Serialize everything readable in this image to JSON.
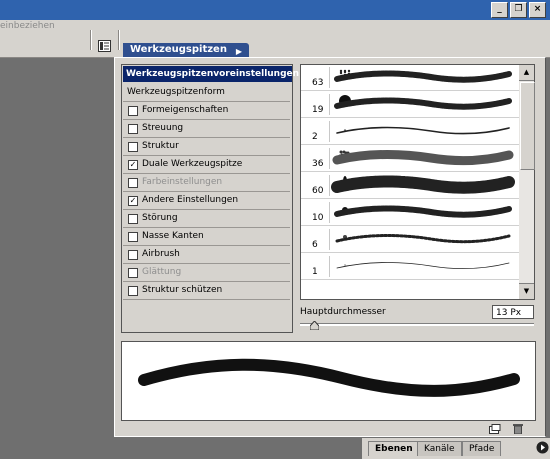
{
  "options_bar": {
    "partial_text": "einbeziehen"
  },
  "window_buttons": [
    "_",
    "❐",
    "×"
  ],
  "palette": {
    "tab_label": "Werkzeugspitzen",
    "tab_arrow": "▶",
    "left_panel": {
      "header": "Werkzeugspitzenvoreinstellungen",
      "items": [
        {
          "label": "Werkzeugspitzenform",
          "checkbox": false,
          "checked": false,
          "enabled": true
        },
        {
          "label": "Formeigenschaften",
          "checkbox": true,
          "checked": false,
          "enabled": true
        },
        {
          "label": "Streuung",
          "checkbox": true,
          "checked": false,
          "enabled": true
        },
        {
          "label": "Struktur",
          "checkbox": true,
          "checked": false,
          "enabled": true
        },
        {
          "label": "Duale Werkzeugspitze",
          "checkbox": true,
          "checked": true,
          "enabled": true
        },
        {
          "label": "Farbeinstellungen",
          "checkbox": true,
          "checked": false,
          "enabled": false
        },
        {
          "label": "Andere Einstellungen",
          "checkbox": true,
          "checked": true,
          "enabled": true
        },
        {
          "label": "Störung",
          "checkbox": true,
          "checked": false,
          "enabled": true
        },
        {
          "label": "Nasse Kanten",
          "checkbox": true,
          "checked": false,
          "enabled": true
        },
        {
          "label": "Airbrush",
          "checkbox": true,
          "checked": false,
          "enabled": true
        },
        {
          "label": "Glättung",
          "checkbox": true,
          "checked": false,
          "enabled": false
        },
        {
          "label": "Struktur schützen",
          "checkbox": true,
          "checked": false,
          "enabled": true
        }
      ]
    },
    "brushes": [
      {
        "size": "63",
        "style": "spatter"
      },
      {
        "size": "19",
        "style": "spatter"
      },
      {
        "size": "2",
        "style": "thin"
      },
      {
        "size": "36",
        "style": "rough"
      },
      {
        "size": "60",
        "style": "grass"
      },
      {
        "size": "10",
        "style": "spatter"
      },
      {
        "size": "6",
        "style": "dotted"
      },
      {
        "size": "1",
        "style": "hair"
      }
    ],
    "diameter": {
      "label": "Hauptdurchmesser",
      "value": "13 Px",
      "fraction": 0.06
    },
    "scroll_up": "▲",
    "scroll_down": "▼"
  },
  "layers_tabs": [
    "Ebenen",
    "Kanäle",
    "Pfade"
  ],
  "colors": {
    "title_blue": "#2f63ae",
    "panel_gray": "#d6d3ce",
    "header_navy": "#0a246a",
    "background": "#6f6f6f"
  }
}
